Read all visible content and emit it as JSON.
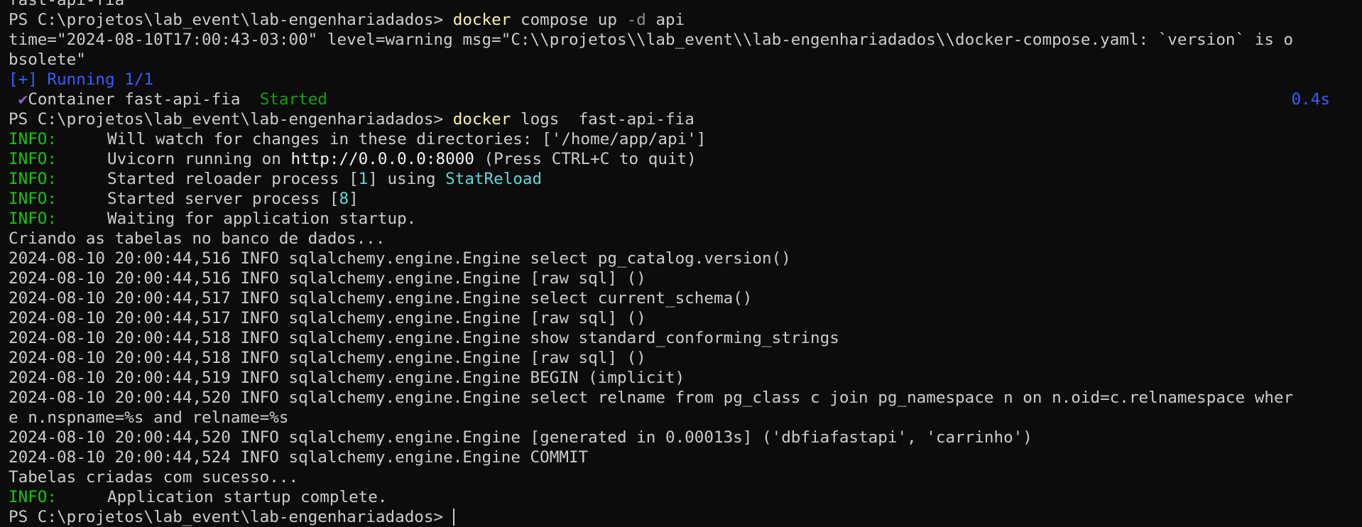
{
  "terminal": {
    "prompt": "PS C:\\projetos\\lab_event\\lab-engenhariadados>",
    "line0": "fast-api-fia",
    "cmd1": {
      "exe": "docker",
      "args1": "compose up",
      "flag": "-d",
      "args2": "api"
    },
    "warn1": "time=\"2024-08-10T17:00:43-03:00\" level=warning msg=\"C:\\\\projetos\\\\lab_event\\\\lab-engenhariadados\\\\docker-compose.yaml: `version` is o",
    "warn2": "bsolete\"",
    "running": "[+] Running 1/1",
    "check": "✔",
    "container": "Container fast-api-fia",
    "container_status": "Started",
    "container_time": "0.4s",
    "cmd2": {
      "exe": "docker",
      "args": "logs  fast-api-fia"
    },
    "info_label": "INFO:",
    "info1": "Will watch for changes in these directories: ['/home/app/api']",
    "info2": {
      "pre": "Uvicorn running on ",
      "url": "http://0.0.0.0:8000",
      "post": " (Press CTRL+C to quit)"
    },
    "info3": {
      "pre": "Started reloader process [",
      "num": "1",
      "mid": "] using ",
      "name": "StatReload"
    },
    "info4": {
      "pre": "Started server process [",
      "num": "8",
      "post": "]"
    },
    "info5": "Waiting for application startup.",
    "log": [
      "Criando as tabelas no banco de dados...",
      "2024-08-10 20:00:44,516 INFO sqlalchemy.engine.Engine select pg_catalog.version()",
      "2024-08-10 20:00:44,516 INFO sqlalchemy.engine.Engine [raw sql] ()",
      "2024-08-10 20:00:44,517 INFO sqlalchemy.engine.Engine select current_schema()",
      "2024-08-10 20:00:44,517 INFO sqlalchemy.engine.Engine [raw sql] ()",
      "2024-08-10 20:00:44,518 INFO sqlalchemy.engine.Engine show standard_conforming_strings",
      "2024-08-10 20:00:44,518 INFO sqlalchemy.engine.Engine [raw sql] ()",
      "2024-08-10 20:00:44,519 INFO sqlalchemy.engine.Engine BEGIN (implicit)",
      "2024-08-10 20:00:44,520 INFO sqlalchemy.engine.Engine select relname from pg_class c join pg_namespace n on n.oid=c.relnamespace wher",
      "e n.nspname=%s and relname=%s",
      "2024-08-10 20:00:44,520 INFO sqlalchemy.engine.Engine [generated in 0.00013s] ('dbfiafastapi', 'carrinho')",
      "2024-08-10 20:00:44,524 INFO sqlalchemy.engine.Engine COMMIT",
      "Tabelas criadas com sucesso..."
    ],
    "info6": "Application startup complete."
  }
}
